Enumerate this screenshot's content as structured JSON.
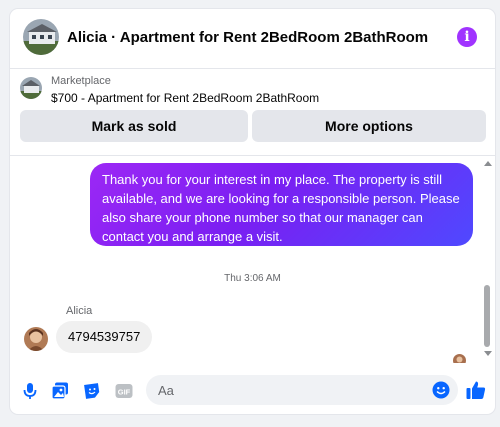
{
  "header": {
    "title": "Alicia · Apartment for Rent 2BedRoom 2BathRoom",
    "info_icon": "info-icon",
    "info_glyph": "i"
  },
  "marketplace": {
    "label": "Marketplace",
    "item": "$700 - Apartment for Rent 2BedRoom 2BathRoom",
    "mark_sold_label": "Mark as sold",
    "more_options_label": "More options"
  },
  "messages": {
    "outgoing": "Thank you for your interest in my place. The property is still available, and we are looking for a responsible person. Please also share your phone number so that our manager can contact you and arrange a visit.",
    "timestamp": "Thu 3:06 AM",
    "sender_name": "Alicia",
    "incoming": "4794539757"
  },
  "composer": {
    "placeholder": "Aa",
    "icons": [
      "microphone-icon",
      "photo-icon",
      "sticker-icon",
      "gif-icon",
      "emoji-icon",
      "thumbs-up-icon"
    ],
    "gif_label": "GIF"
  },
  "colors": {
    "accent": "#0866ff",
    "info": "#a033ff",
    "bubble_gradient_start": "#9c28f5",
    "bubble_gradient_end": "#4f49ff"
  }
}
